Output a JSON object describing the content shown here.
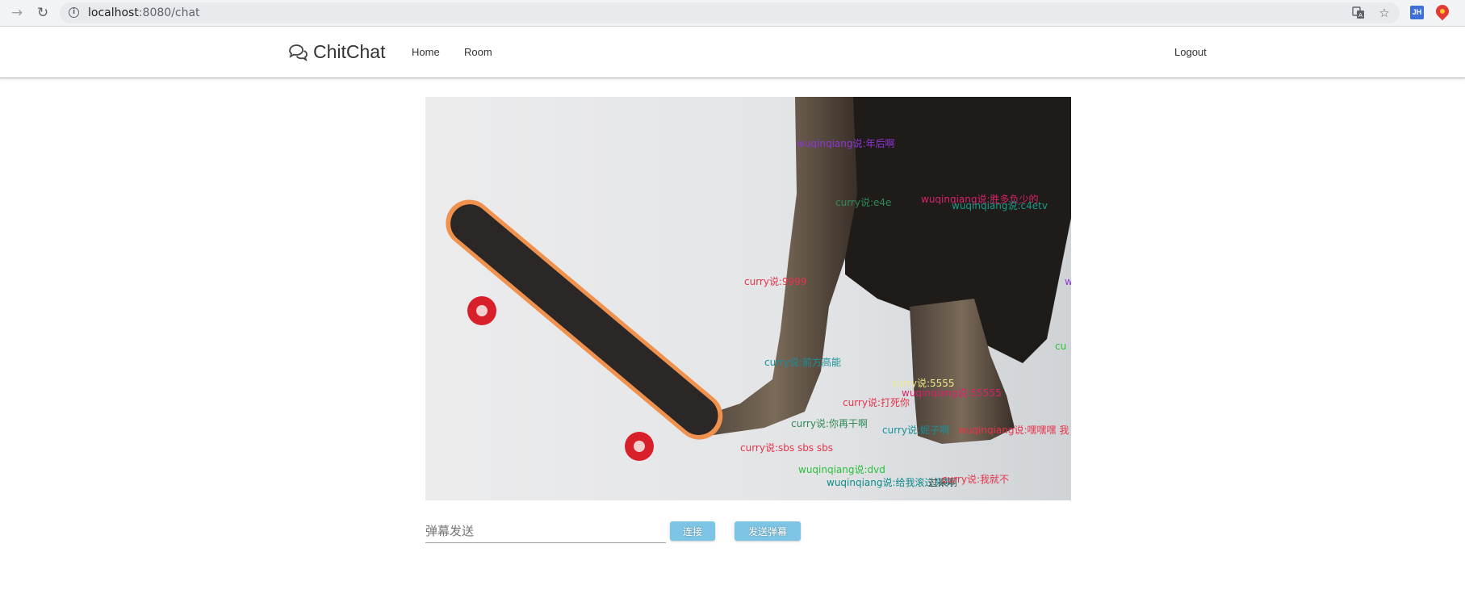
{
  "browser": {
    "url_host": "localhost",
    "url_path": ":8080/chat",
    "extension_label": "JH"
  },
  "nav": {
    "brand": "ChitChat",
    "home": "Home",
    "room": "Room",
    "logout": "Logout"
  },
  "danmaku": [
    {
      "text": "wuqinqiang说:年后啊",
      "color": "#8e36d6"
    },
    {
      "text": "curry说:e4e",
      "color": "#2e8b57"
    },
    {
      "text": "wuqinqiang说:胜多负少的",
      "color": "#d6246c"
    },
    {
      "text": "wuqinqiang说:c4etv",
      "color": "#1a9b8a"
    },
    {
      "text": "curry说:9999",
      "color": "#e8334a"
    },
    {
      "text": "curry说:前方高能",
      "color": "#179099"
    },
    {
      "text": "curry说:5555",
      "color": "#f0e88a"
    },
    {
      "text": "wuqinqiang说:55555",
      "color": "#d6246c"
    },
    {
      "text": "curry说:打死你",
      "color": "#e8334a"
    },
    {
      "text": "curry说:你再干啊",
      "color": "#2e8b57"
    },
    {
      "text": "curry说:妮子啊",
      "color": "#179099"
    },
    {
      "text": "wuqinqiang说:嘿嘿嘿 我",
      "color": "#e8334a"
    },
    {
      "text": "curry说:sbs sbs sbs",
      "color": "#e8334a"
    },
    {
      "text": "wuqinqiang说:dvd",
      "color": "#2bbf3a"
    },
    {
      "text": "wuqinqiang说:给我滚过来啊",
      "color": "#0f8a8a"
    },
    {
      "text": "过来啊",
      "color": "#444444"
    },
    {
      "text": "curry说:我就不",
      "color": "#e8334a"
    },
    {
      "text": "w",
      "color": "#8e36d6"
    },
    {
      "text": "cu",
      "color": "#2bbf3a"
    }
  ],
  "controls": {
    "input_placeholder": "弹幕发送",
    "connect": "连接",
    "send": "发送弹幕"
  }
}
